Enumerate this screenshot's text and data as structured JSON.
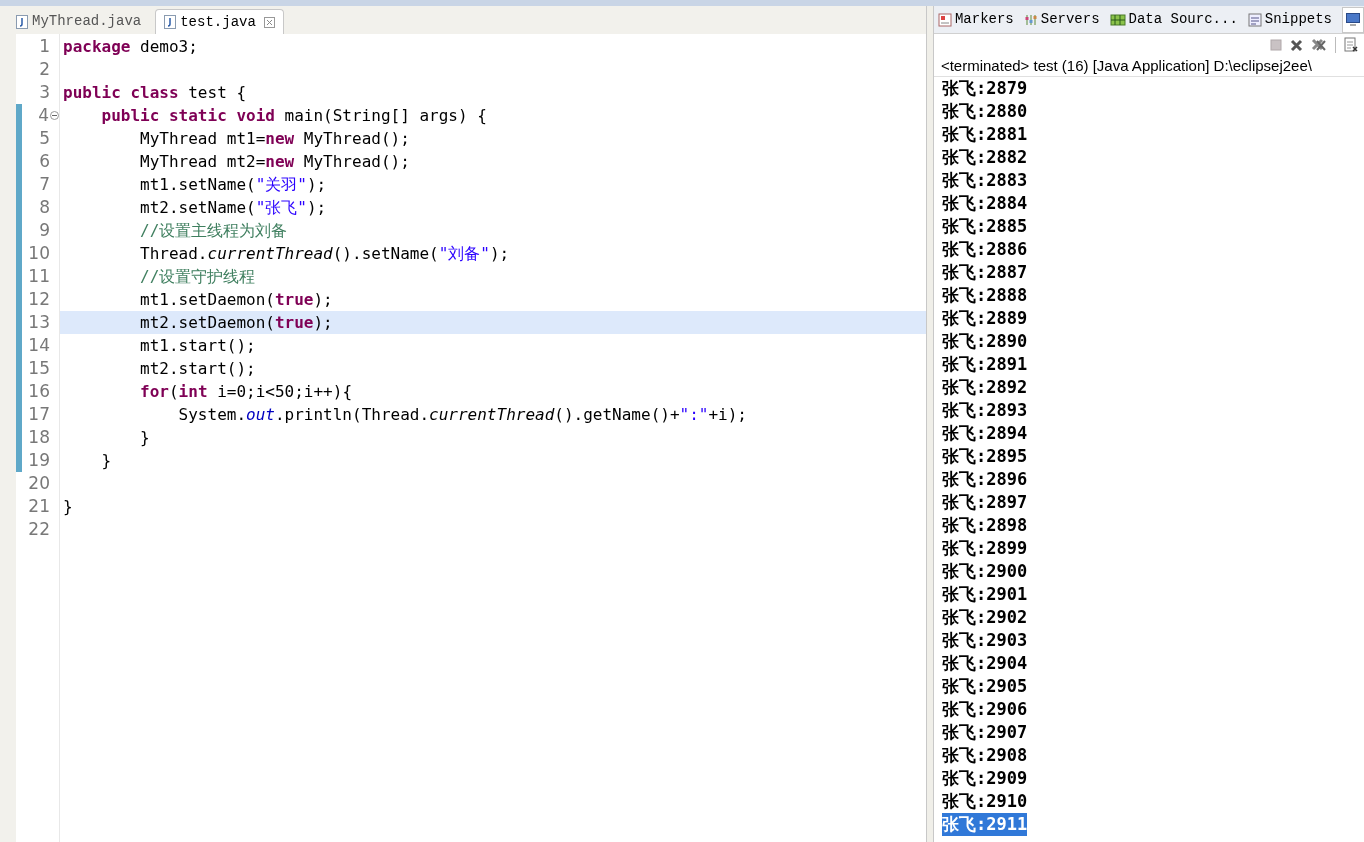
{
  "editor": {
    "tabs": [
      {
        "label": "MyThread.java",
        "selected": false,
        "closable": false
      },
      {
        "label": "test.java",
        "selected": true,
        "closable": true
      }
    ],
    "lines": [
      {
        "number": "1",
        "changed": false,
        "current": false,
        "foldable": false,
        "tokens": [
          {
            "text": "package",
            "kind": "keyword"
          },
          {
            "text": " demo3;",
            "kind": "plain"
          }
        ]
      },
      {
        "number": "2",
        "changed": false,
        "current": false,
        "foldable": false
      },
      {
        "number": "3",
        "changed": false,
        "current": false,
        "foldable": false,
        "tokens": [
          {
            "text": "public class",
            "kind": "keyword"
          },
          {
            "text": " test {",
            "kind": "plain"
          }
        ]
      },
      {
        "number": "4",
        "changed": true,
        "current": false,
        "foldable": true,
        "tokens": [
          {
            "text": "    public static void",
            "kind": "keyword"
          },
          {
            "text": " main(String[] args) {",
            "kind": "plain"
          }
        ]
      },
      {
        "number": "5",
        "changed": true,
        "current": false,
        "foldable": false,
        "tokens": [
          {
            "text": "        MyThread mt1=",
            "kind": "plain"
          },
          {
            "text": "new",
            "kind": "keyword"
          },
          {
            "text": " MyThread();",
            "kind": "plain"
          }
        ]
      },
      {
        "number": "6",
        "changed": true,
        "current": false,
        "foldable": false,
        "tokens": [
          {
            "text": "        MyThread mt2=",
            "kind": "plain"
          },
          {
            "text": "new",
            "kind": "keyword"
          },
          {
            "text": " MyThread();",
            "kind": "plain"
          }
        ]
      },
      {
        "number": "7",
        "changed": true,
        "current": false,
        "foldable": false,
        "tokens": [
          {
            "text": "        mt1.setName(",
            "kind": "plain"
          },
          {
            "text": "\"关羽\"",
            "kind": "string"
          },
          {
            "text": ");",
            "kind": "plain"
          }
        ]
      },
      {
        "number": "8",
        "changed": true,
        "current": false,
        "foldable": false,
        "tokens": [
          {
            "text": "        mt2.setName(",
            "kind": "plain"
          },
          {
            "text": "\"张飞\"",
            "kind": "string"
          },
          {
            "text": ");",
            "kind": "plain"
          }
        ]
      },
      {
        "number": "9",
        "changed": true,
        "current": false,
        "foldable": false,
        "tokens": [
          {
            "text": "        //设置主线程为刘备",
            "kind": "comment"
          }
        ]
      },
      {
        "number": "10",
        "changed": true,
        "current": false,
        "foldable": false,
        "tokens": [
          {
            "text": "        Thread.",
            "kind": "plain"
          },
          {
            "text": "currentThread",
            "kind": "static"
          },
          {
            "text": "().setName(",
            "kind": "plain"
          },
          {
            "text": "\"刘备\"",
            "kind": "string"
          },
          {
            "text": ");",
            "kind": "plain"
          }
        ]
      },
      {
        "number": "11",
        "changed": true,
        "current": false,
        "foldable": false,
        "tokens": [
          {
            "text": "        //设置守护线程",
            "kind": "comment"
          }
        ]
      },
      {
        "number": "12",
        "changed": true,
        "current": false,
        "foldable": false,
        "tokens": [
          {
            "text": "        mt1.setDaemon(",
            "kind": "plain"
          },
          {
            "text": "true",
            "kind": "keyword"
          },
          {
            "text": ");",
            "kind": "plain"
          }
        ]
      },
      {
        "number": "13",
        "changed": true,
        "current": true,
        "foldable": false,
        "tokens": [
          {
            "text": "        mt2.setDaemon(",
            "kind": "plain"
          },
          {
            "text": "true",
            "kind": "keyword"
          },
          {
            "text": ");",
            "kind": "plain"
          }
        ]
      },
      {
        "number": "14",
        "changed": true,
        "current": false,
        "foldable": false,
        "tokens": [
          {
            "text": "        mt1.start();",
            "kind": "plain"
          }
        ]
      },
      {
        "number": "15",
        "changed": true,
        "current": false,
        "foldable": false,
        "tokens": [
          {
            "text": "        mt2.start();",
            "kind": "plain"
          }
        ]
      },
      {
        "number": "16",
        "changed": true,
        "current": false,
        "foldable": false,
        "tokens": [
          {
            "text": "        for",
            "kind": "keyword"
          },
          {
            "text": "(",
            "kind": "plain"
          },
          {
            "text": "int",
            "kind": "keyword"
          },
          {
            "text": " i=0;i<50;i++){",
            "kind": "plain"
          }
        ]
      },
      {
        "number": "17",
        "changed": true,
        "current": false,
        "foldable": false,
        "tokens": [
          {
            "text": "            System.",
            "kind": "plain"
          },
          {
            "text": "out",
            "kind": "field"
          },
          {
            "text": ".println(Thread.",
            "kind": "plain"
          },
          {
            "text": "currentThread",
            "kind": "static"
          },
          {
            "text": "().getName()+",
            "kind": "plain"
          },
          {
            "text": "\":\"",
            "kind": "string"
          },
          {
            "text": "+i);",
            "kind": "plain"
          }
        ]
      },
      {
        "number": "18",
        "changed": true,
        "current": false,
        "foldable": false,
        "tokens": [
          {
            "text": "        }",
            "kind": "plain"
          }
        ]
      },
      {
        "number": "19",
        "changed": true,
        "current": false,
        "foldable": false,
        "tokens": [
          {
            "text": "    }",
            "kind": "plain"
          }
        ]
      },
      {
        "number": "20",
        "changed": false,
        "current": false,
        "foldable": false
      },
      {
        "number": "21",
        "changed": false,
        "current": false,
        "foldable": false,
        "tokens": [
          {
            "text": "}",
            "kind": "plain"
          }
        ]
      },
      {
        "number": "22",
        "changed": false,
        "current": false,
        "foldable": false
      }
    ]
  },
  "console": {
    "tabs": [
      {
        "label": "Markers",
        "kind": "markers"
      },
      {
        "label": "Servers",
        "kind": "servers"
      },
      {
        "label": "Data Sourc...",
        "kind": "data"
      },
      {
        "label": "Snippets",
        "kind": "snippets"
      }
    ],
    "status": "<terminated> test (16) [Java Application] D:\\eclipsej2ee\\",
    "output": [
      {
        "text": "张飞:2879",
        "selected": false
      },
      {
        "text": "张飞:2880",
        "selected": false
      },
      {
        "text": "张飞:2881",
        "selected": false
      },
      {
        "text": "张飞:2882",
        "selected": false
      },
      {
        "text": "张飞:2883",
        "selected": false
      },
      {
        "text": "张飞:2884",
        "selected": false
      },
      {
        "text": "张飞:2885",
        "selected": false
      },
      {
        "text": "张飞:2886",
        "selected": false
      },
      {
        "text": "张飞:2887",
        "selected": false
      },
      {
        "text": "张飞:2888",
        "selected": false
      },
      {
        "text": "张飞:2889",
        "selected": false
      },
      {
        "text": "张飞:2890",
        "selected": false
      },
      {
        "text": "张飞:2891",
        "selected": false
      },
      {
        "text": "张飞:2892",
        "selected": false
      },
      {
        "text": "张飞:2893",
        "selected": false
      },
      {
        "text": "张飞:2894",
        "selected": false
      },
      {
        "text": "张飞:2895",
        "selected": false
      },
      {
        "text": "张飞:2896",
        "selected": false
      },
      {
        "text": "张飞:2897",
        "selected": false
      },
      {
        "text": "张飞:2898",
        "selected": false
      },
      {
        "text": "张飞:2899",
        "selected": false
      },
      {
        "text": "张飞:2900",
        "selected": false
      },
      {
        "text": "张飞:2901",
        "selected": false
      },
      {
        "text": "张飞:2902",
        "selected": false
      },
      {
        "text": "张飞:2903",
        "selected": false
      },
      {
        "text": "张飞:2904",
        "selected": false
      },
      {
        "text": "张飞:2905",
        "selected": false
      },
      {
        "text": "张飞:2906",
        "selected": false
      },
      {
        "text": "张飞:2907",
        "selected": false
      },
      {
        "text": "张飞:2908",
        "selected": false
      },
      {
        "text": "张飞:2909",
        "selected": false
      },
      {
        "text": "张飞:2910",
        "selected": false
      },
      {
        "text": "张飞:2911",
        "selected": true
      }
    ]
  }
}
